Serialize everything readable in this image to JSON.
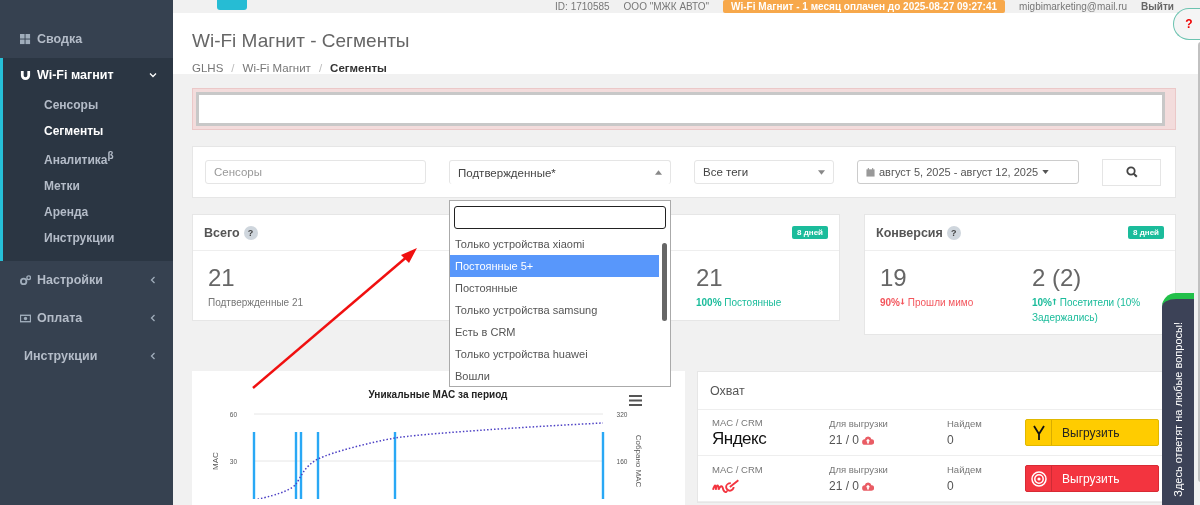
{
  "topbar": {
    "account": "ID: 1710585",
    "company": "ООО \"МЖК АВТО\"",
    "notice": "Wi-Fi Магнит - 1 месяц оплачен до 2025-08-27 09:27:41",
    "email": "migbimarketing@mail.ru",
    "logout": "Выйти"
  },
  "sidebar": {
    "items": [
      {
        "label": "Сводка",
        "kind": "dashboard",
        "expanded": false,
        "has_caret": false
      },
      {
        "label": "Wi-Fi магнит",
        "kind": "magnet",
        "expanded": true,
        "has_caret": true,
        "children": [
          {
            "label": "Сенсоры",
            "selected": false
          },
          {
            "label": "Сегменты",
            "selected": true
          },
          {
            "label": "Аналитика$^{β}$",
            "selected": false
          },
          {
            "label": "Метки",
            "selected": false
          },
          {
            "label": "Аренда",
            "selected": false
          },
          {
            "label": "Инструкции",
            "selected": false
          }
        ]
      },
      {
        "label": "Настройки",
        "kind": "settings",
        "expanded": false,
        "has_caret": true
      },
      {
        "label": "Оплата",
        "kind": "payment",
        "expanded": false,
        "has_caret": true
      },
      {
        "label": "Инструкции",
        "kind": "plain",
        "expanded": false,
        "has_caret": true
      }
    ]
  },
  "page": {
    "title": "Wi-Fi Магнит - Сегменты",
    "breadcrumb_separator": "/",
    "breadcrumbs": [
      "GLHS",
      "Wi-Fi Магнит",
      "Сегменты"
    ]
  },
  "filters": {
    "sensors_placeholder": "Сенсоры",
    "segment": "Подтвержденные*",
    "segment_expanded": true,
    "tags": "Все теги",
    "date_range": "август 5, 2025 - август 12, 2025"
  },
  "segment_options": [
    {
      "label": "Только устройства xiaomi",
      "selected": false
    },
    {
      "label": "Постоянные 5+",
      "selected": true
    },
    {
      "label": "Постоянные",
      "selected": false
    },
    {
      "label": "Только устройства samsung",
      "selected": false
    },
    {
      "label": "Есть в CRM",
      "selected": false
    },
    {
      "label": "Только устройства huawei",
      "selected": false
    },
    {
      "label": "Вошли",
      "selected": false
    }
  ],
  "stats": [
    {
      "title": "Всего",
      "help_mark": "?",
      "badge": "8 дней",
      "metrics": [
        {
          "value": "21",
          "kind": "plain",
          "caption": "Подтвержденные 21",
          "color": "#777777"
        },
        {
          "value": "21",
          "kind": "plain",
          "percent": "100%",
          "caption": "Постоянные",
          "color": "#1bbc9b"
        }
      ]
    },
    {
      "title": "Конверсия",
      "help_mark": "?",
      "badge": "8 дней",
      "metrics": [
        {
          "value": "19",
          "kind": "down",
          "percent": "90%",
          "caption": "Прошли мимо",
          "color": "#f3565d"
        },
        {
          "value": "2 (2)",
          "kind": "up",
          "percent": "10%",
          "caption": "Посетители (10% Задержались)",
          "color": "#1bbc9b"
        }
      ]
    }
  ],
  "chart": {
    "title": "Уникальные MAC за период",
    "ylabel": "MAC",
    "y2label": "Собрано MAC",
    "yticks": [
      "60",
      "30"
    ],
    "y2ticks": [
      "320",
      "160"
    ]
  },
  "reach": {
    "title": "Охват",
    "rows": [
      {
        "kind": "yandex",
        "label": "MAC / CRM",
        "logo": "Яндекс",
        "export_label": "Для выгрузки",
        "export_value": "21 / 0",
        "found_label": "Найдем",
        "found_value": "0",
        "button": "Выгрузить"
      },
      {
        "kind": "mytarget",
        "label": "MAC / CRM",
        "export_label": "Для выгрузки",
        "export_value": "21 / 0",
        "found_label": "Найдем",
        "found_value": "0",
        "button": "Выгрузить"
      }
    ]
  },
  "help": "?",
  "feedback": "Здесь ответят на любые вопросы!"
}
